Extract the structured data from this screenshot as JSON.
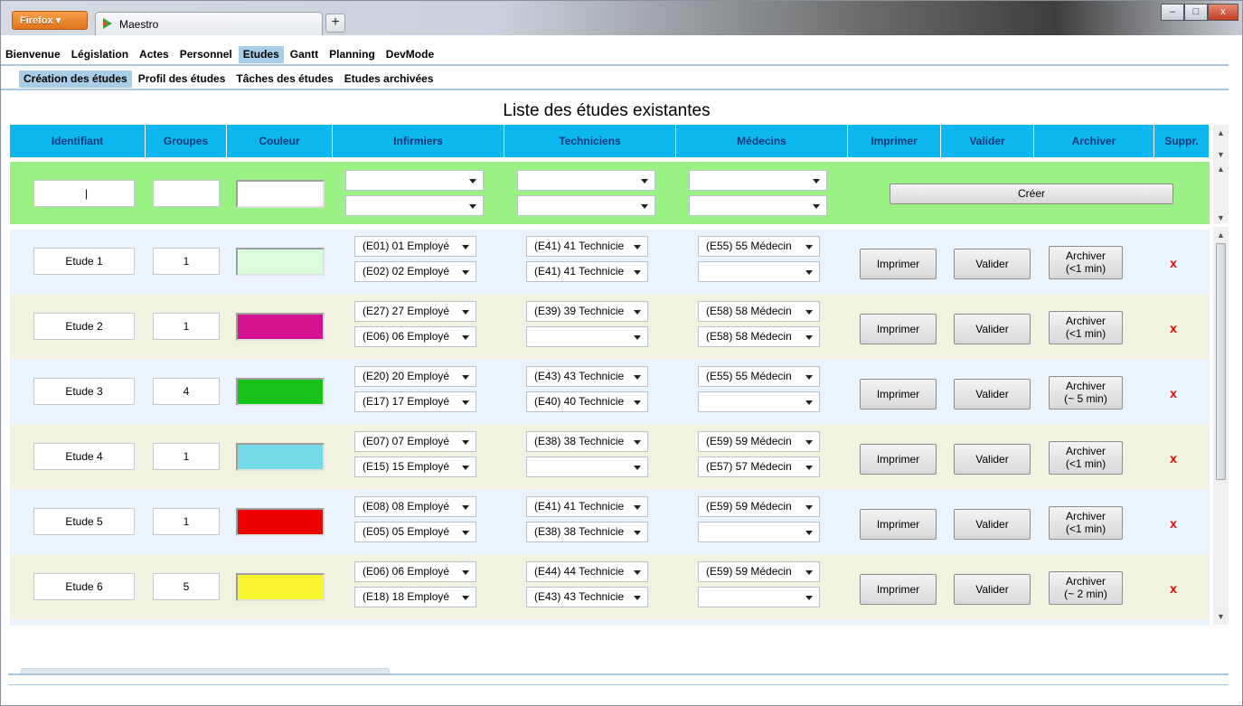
{
  "browser": {
    "brand_button": "Firefox ▾",
    "tab_title": "Maestro",
    "new_tab": "+",
    "win_min": "–",
    "win_max": "□",
    "win_close": "x"
  },
  "menu": {
    "items": [
      {
        "label": "Bienvenue",
        "active": false
      },
      {
        "label": "Législation",
        "active": false
      },
      {
        "label": "Actes",
        "active": false
      },
      {
        "label": "Personnel",
        "active": false
      },
      {
        "label": "Etudes",
        "active": true
      },
      {
        "label": "Gantt",
        "active": false
      },
      {
        "label": "Planning",
        "active": false
      },
      {
        "label": "DevMode",
        "active": false
      }
    ]
  },
  "submenu": {
    "items": [
      {
        "label": "Création des études",
        "active": true
      },
      {
        "label": "Profil des études",
        "active": false
      },
      {
        "label": "Tâches des études",
        "active": false
      },
      {
        "label": "Etudes archivées",
        "active": false
      }
    ]
  },
  "title": "Liste des études existantes",
  "columns": [
    "Identifiant",
    "Groupes",
    "Couleur",
    "Infirmiers",
    "Techniciens",
    "Médecins",
    "Imprimer",
    "Valider",
    "Archiver",
    "Suppr."
  ],
  "new_row": {
    "identifiant": "|",
    "groupes": "",
    "create_label": "Créer"
  },
  "print_label": "Imprimer",
  "validate_label": "Valider",
  "delete_label": "x",
  "rows": [
    {
      "id": "Etude 1",
      "groups": "1",
      "color": "#dcfbdc",
      "inf": [
        "(E01) 01 Employé",
        "(E02) 02 Employé"
      ],
      "tech": [
        "(E41) 41 Technicie",
        "(E41) 41 Technicie"
      ],
      "med": [
        "(E55) 55 Médecin",
        ""
      ],
      "archive": [
        "Archiver",
        "(<1 min)"
      ]
    },
    {
      "id": "Etude 2",
      "groups": "1",
      "color": "#d4118f",
      "inf": [
        "(E27) 27 Employé",
        "(E06) 06 Employé"
      ],
      "tech": [
        "(E39) 39 Technicie",
        ""
      ],
      "med": [
        "(E58) 58 Médecin",
        "(E58) 58 Médecin"
      ],
      "archive": [
        "Archiver",
        "(<1 min)"
      ]
    },
    {
      "id": "Etude 3",
      "groups": "4",
      "color": "#18c218",
      "inf": [
        "(E20) 20 Employé",
        "(E17) 17 Employé"
      ],
      "tech": [
        "(E43) 43 Technicie",
        "(E40) 40 Technicie"
      ],
      "med": [
        "(E55) 55 Médecin",
        ""
      ],
      "archive": [
        "Archiver",
        "(~ 5 min)"
      ]
    },
    {
      "id": "Etude 4",
      "groups": "1",
      "color": "#76d9e6",
      "inf": [
        "(E07) 07 Employé",
        "(E15) 15 Employé"
      ],
      "tech": [
        "(E38) 38 Technicie",
        ""
      ],
      "med": [
        "(E59) 59 Médecin",
        "(E57) 57 Médecin"
      ],
      "archive": [
        "Archiver",
        "(<1 min)"
      ]
    },
    {
      "id": "Etude 5",
      "groups": "1",
      "color": "#ef0000",
      "inf": [
        "(E08) 08 Employé",
        "(E05) 05 Employé"
      ],
      "tech": [
        "(E41) 41 Technicie",
        "(E38) 38 Technicie"
      ],
      "med": [
        "(E59) 59 Médecin",
        ""
      ],
      "archive": [
        "Archiver",
        "(<1 min)"
      ]
    },
    {
      "id": "Etude 6",
      "groups": "5",
      "color": "#f7f52f",
      "inf": [
        "(E06) 06 Employé",
        "(E18) 18 Employé"
      ],
      "tech": [
        "(E44) 44 Technicie",
        "(E43) 43 Technicie"
      ],
      "med": [
        "(E59) 59 Médecin",
        ""
      ],
      "archive": [
        "Archiver",
        "(~ 2 min)"
      ]
    }
  ],
  "colors": {
    "header_bg": "#0cb6ef",
    "header_text": "#003a7a",
    "new_row_bg": "#9cf184",
    "row_odd": "#eaf4fc",
    "row_even": "#f1f2df",
    "delete": "#e60000"
  }
}
